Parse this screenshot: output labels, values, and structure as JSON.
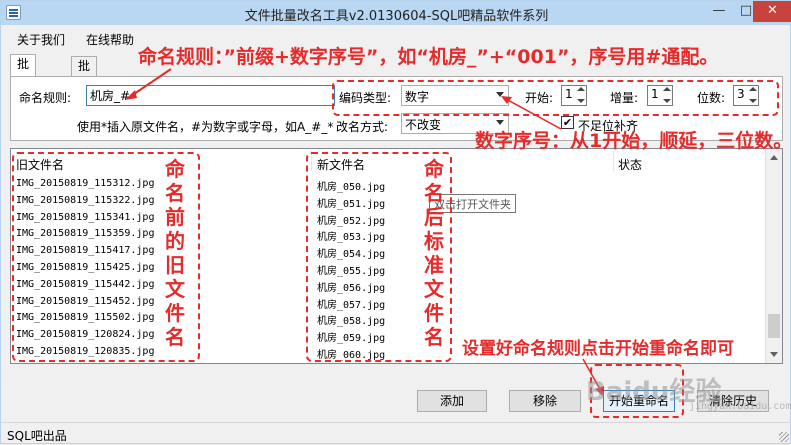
{
  "window": {
    "title": "文件批量改名工具v2.0130604-SQL吧精品软件系列",
    "minimize": "—",
    "maximize": "□",
    "close": "✕"
  },
  "menu": [
    "关于我们",
    "在线帮助"
  ],
  "tabs": [
    "批量改名",
    "批量替换"
  ],
  "form": {
    "rule_label": "命名规则:",
    "rule_value": "机房_#",
    "hint": "使用*插入原文件名，#为数字或字母，如A_#_*",
    "encoding_label": "编码类型:",
    "encoding_value": "数字",
    "start_label": "开始:",
    "start_value": "1",
    "step_label": "增量:",
    "step_value": "1",
    "digits_label": "位数:",
    "digits_value": "3",
    "rename_mode_label": "改名方式:",
    "rename_mode_value": "不改变",
    "pad_label": "不足位补齐",
    "pad_checked": "✔"
  },
  "list": {
    "columns": [
      "旧文件名",
      "新文件名",
      "状态"
    ],
    "old_names": [
      "IMG_20150819_115312.jpg",
      "IMG_20150819_115322.jpg",
      "IMG_20150819_115341.jpg",
      "IMG_20150819_115359.jpg",
      "IMG_20150819_115417.jpg",
      "IMG_20150819_115425.jpg",
      "IMG_20150819_115442.jpg",
      "IMG_20150819_115452.jpg",
      "IMG_20150819_115502.jpg",
      "IMG_20150819_120824.jpg",
      "IMG_20150819_120835.jpg"
    ],
    "new_names": [
      "机房_050.jpg",
      "机房_051.jpg",
      "机房_052.jpg",
      "机房_053.jpg",
      "机房_054.jpg",
      "机房_055.jpg",
      "机房_056.jpg",
      "机房_057.jpg",
      "机房_058.jpg",
      "机房_059.jpg",
      "机房_060.jpg"
    ],
    "tooltip": "双击打开文件夹"
  },
  "buttons": {
    "add": "添加",
    "remove": "移除",
    "start": "开始重命名",
    "clear": "清除历史"
  },
  "status": "SQL吧出品",
  "annotations": {
    "rule": "命名规则：”前缀+数字序号”，如“机房_”+“001”，序号用#通配。",
    "sequence": "数字序号：从1开始，顺延，三位数。",
    "before": "命名前的旧文件名",
    "after": "命名后标准文件名",
    "action": "设置好命名规则点击开始重命名即可"
  },
  "watermark": {
    "main": "Baidu经验",
    "sub": "jingyan.baidu.com"
  },
  "colors": {
    "annotation": "#e52b2b",
    "titlebar": "#b9d6f2",
    "close_button": "#c7423b"
  }
}
